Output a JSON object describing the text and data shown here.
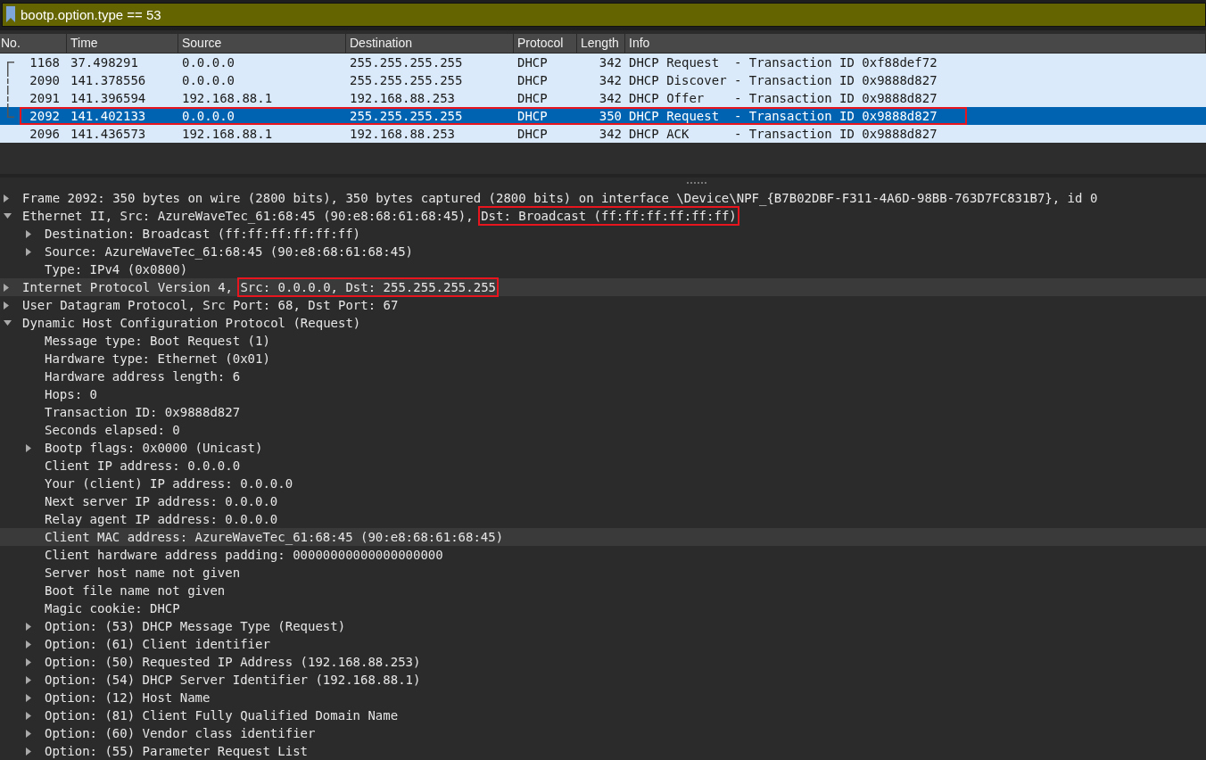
{
  "filter_bar": {
    "value": "bootp.option.type == 53"
  },
  "packet_list": {
    "columns": [
      "No.",
      "Time",
      "Source",
      "Destination",
      "Protocol",
      "Length",
      "Info"
    ],
    "rows": [
      {
        "cells": [
          "1168",
          "37.498291",
          "0.0.0.0",
          "255.255.255.255",
          "DHCP",
          "342",
          "DHCP Request  - Transaction ID 0xf88def72"
        ],
        "selected": false,
        "outlined": false,
        "kind": "start"
      },
      {
        "cells": [
          "2090",
          "141.378556",
          "0.0.0.0",
          "255.255.255.255",
          "DHCP",
          "342",
          "DHCP Discover - Transaction ID 0x9888d827"
        ],
        "selected": false,
        "outlined": false,
        "kind": "middle"
      },
      {
        "cells": [
          "2091",
          "141.396594",
          "192.168.88.1",
          "192.168.88.253",
          "DHCP",
          "342",
          "DHCP Offer    - Transaction ID 0x9888d827"
        ],
        "selected": false,
        "outlined": false,
        "kind": "middle"
      },
      {
        "cells": [
          "2092",
          "141.402133",
          "0.0.0.0",
          "255.255.255.255",
          "DHCP",
          "350",
          "DHCP Request  - Transaction ID 0x9888d827"
        ],
        "selected": true,
        "outlined": true,
        "kind": "end"
      },
      {
        "cells": [
          "2096",
          "141.436573",
          "192.168.88.1",
          "192.168.88.253",
          "DHCP",
          "342",
          "DHCP ACK      - Transaction ID 0x9888d827"
        ],
        "selected": false,
        "outlined": false,
        "kind": "plain"
      }
    ]
  },
  "details": [
    {
      "kind": "branch",
      "expanded": false,
      "selected": false,
      "segments": [
        {
          "text": "Frame 2092: 350 bytes on wire (2800 bits), 350 bytes captured (2800 bits) on interface \\Device\\NPF_{B7B02DBF-F311-4A6D-98BB-763D7FC831B7}, id 0",
          "boxed": false
        }
      ]
    },
    {
      "kind": "branch",
      "expanded": true,
      "selected": false,
      "segments": [
        {
          "text": "Ethernet II, Src: AzureWaveTec_61:68:45 (90:e8:68:61:68:45), ",
          "boxed": false
        },
        {
          "text": "Dst: Broadcast (ff:ff:ff:ff:ff:ff)",
          "boxed": true
        }
      ],
      "children": [
        {
          "kind": "branch",
          "expanded": false,
          "selected": false,
          "segments": [
            {
              "text": "Destination: Broadcast (ff:ff:ff:ff:ff:ff)",
              "boxed": false
            }
          ]
        },
        {
          "kind": "branch",
          "expanded": false,
          "selected": false,
          "segments": [
            {
              "text": "Source: AzureWaveTec_61:68:45 (90:e8:68:61:68:45)",
              "boxed": false
            }
          ]
        },
        {
          "kind": "leaf",
          "selected": false,
          "segments": [
            {
              "text": "Type: IPv4 (0x0800)",
              "boxed": false
            }
          ]
        }
      ]
    },
    {
      "kind": "branch",
      "expanded": false,
      "selected": true,
      "segments": [
        {
          "text": "Internet Protocol Version 4, ",
          "boxed": false
        },
        {
          "text": "Src: 0.0.0.0, Dst: 255.255.255.255",
          "boxed": true
        }
      ]
    },
    {
      "kind": "branch",
      "expanded": false,
      "selected": false,
      "segments": [
        {
          "text": "User Datagram Protocol, Src Port: 68, Dst Port: 67",
          "boxed": false
        }
      ]
    },
    {
      "kind": "branch",
      "expanded": true,
      "selected": false,
      "segments": [
        {
          "text": "Dynamic Host Configuration Protocol (Request)",
          "boxed": false
        }
      ],
      "children": [
        {
          "kind": "leaf",
          "selected": false,
          "segments": [
            {
              "text": "Message type: Boot Request (1)",
              "boxed": false
            }
          ]
        },
        {
          "kind": "leaf",
          "selected": false,
          "segments": [
            {
              "text": "Hardware type: Ethernet (0x01)",
              "boxed": false
            }
          ]
        },
        {
          "kind": "leaf",
          "selected": false,
          "segments": [
            {
              "text": "Hardware address length: 6",
              "boxed": false
            }
          ]
        },
        {
          "kind": "leaf",
          "selected": false,
          "segments": [
            {
              "text": "Hops: 0",
              "boxed": false
            }
          ]
        },
        {
          "kind": "leaf",
          "selected": false,
          "segments": [
            {
              "text": "Transaction ID: 0x9888d827",
              "boxed": false
            }
          ]
        },
        {
          "kind": "leaf",
          "selected": false,
          "segments": [
            {
              "text": "Seconds elapsed: 0",
              "boxed": false
            }
          ]
        },
        {
          "kind": "branch",
          "expanded": false,
          "selected": false,
          "segments": [
            {
              "text": "Bootp flags: 0x0000 (Unicast)",
              "boxed": false
            }
          ]
        },
        {
          "kind": "leaf",
          "selected": false,
          "segments": [
            {
              "text": "Client IP address: 0.0.0.0",
              "boxed": false
            }
          ]
        },
        {
          "kind": "leaf",
          "selected": false,
          "segments": [
            {
              "text": "Your (client) IP address: 0.0.0.0",
              "boxed": false
            }
          ]
        },
        {
          "kind": "leaf",
          "selected": false,
          "segments": [
            {
              "text": "Next server IP address: 0.0.0.0",
              "boxed": false
            }
          ]
        },
        {
          "kind": "leaf",
          "selected": false,
          "segments": [
            {
              "text": "Relay agent IP address: 0.0.0.0",
              "boxed": false
            }
          ]
        },
        {
          "kind": "leaf",
          "selected": true,
          "segments": [
            {
              "text": "Client MAC address: AzureWaveTec_61:68:45 (90:e8:68:61:68:45)",
              "boxed": false
            }
          ]
        },
        {
          "kind": "leaf",
          "selected": false,
          "segments": [
            {
              "text": "Client hardware address padding: 00000000000000000000",
              "boxed": false
            }
          ]
        },
        {
          "kind": "leaf",
          "selected": false,
          "segments": [
            {
              "text": "Server host name not given",
              "boxed": false
            }
          ]
        },
        {
          "kind": "leaf",
          "selected": false,
          "segments": [
            {
              "text": "Boot file name not given",
              "boxed": false
            }
          ]
        },
        {
          "kind": "leaf",
          "selected": false,
          "segments": [
            {
              "text": "Magic cookie: DHCP",
              "boxed": false
            }
          ]
        },
        {
          "kind": "branch",
          "expanded": false,
          "selected": false,
          "segments": [
            {
              "text": "Option: (53) DHCP Message Type (Request)",
              "boxed": false
            }
          ]
        },
        {
          "kind": "branch",
          "expanded": false,
          "selected": false,
          "segments": [
            {
              "text": "Option: (61) Client identifier",
              "boxed": false
            }
          ]
        },
        {
          "kind": "branch",
          "expanded": false,
          "selected": false,
          "segments": [
            {
              "text": "Option: (50) Requested IP Address (192.168.88.253)",
              "boxed": false
            }
          ]
        },
        {
          "kind": "branch",
          "expanded": false,
          "selected": false,
          "segments": [
            {
              "text": "Option: (54) DHCP Server Identifier (192.168.88.1)",
              "boxed": false
            }
          ]
        },
        {
          "kind": "branch",
          "expanded": false,
          "selected": false,
          "segments": [
            {
              "text": "Option: (12) Host Name",
              "boxed": false
            }
          ]
        },
        {
          "kind": "branch",
          "expanded": false,
          "selected": false,
          "segments": [
            {
              "text": "Option: (81) Client Fully Qualified Domain Name",
              "boxed": false
            }
          ]
        },
        {
          "kind": "branch",
          "expanded": false,
          "selected": false,
          "segments": [
            {
              "text": "Option: (60) Vendor class identifier",
              "boxed": false
            }
          ]
        },
        {
          "kind": "branch",
          "expanded": false,
          "selected": false,
          "segments": [
            {
              "text": "Option: (55) Parameter Request List",
              "boxed": false
            }
          ]
        }
      ]
    }
  ]
}
